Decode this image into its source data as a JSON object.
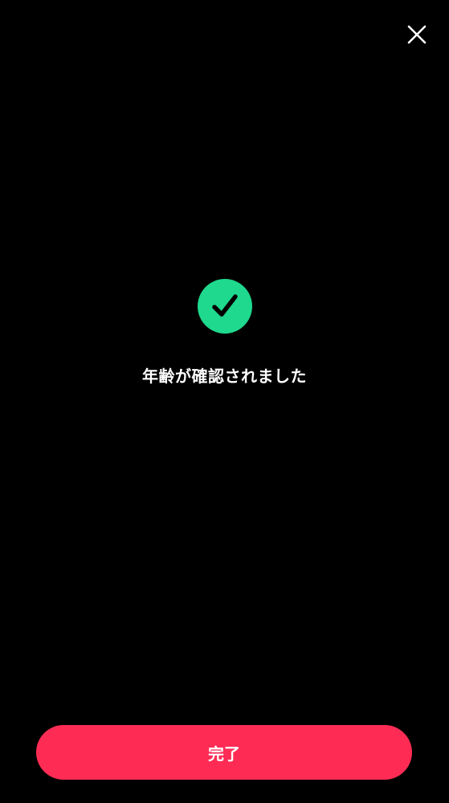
{
  "header": {
    "close_icon": "close-icon"
  },
  "confirmation": {
    "icon": "check-circle-icon",
    "message": "年齢が確認されました"
  },
  "footer": {
    "done_label": "完了"
  },
  "colors": {
    "background": "#000000",
    "success": "#1ed98e",
    "accent": "#fe2c55",
    "text": "#ffffff"
  }
}
